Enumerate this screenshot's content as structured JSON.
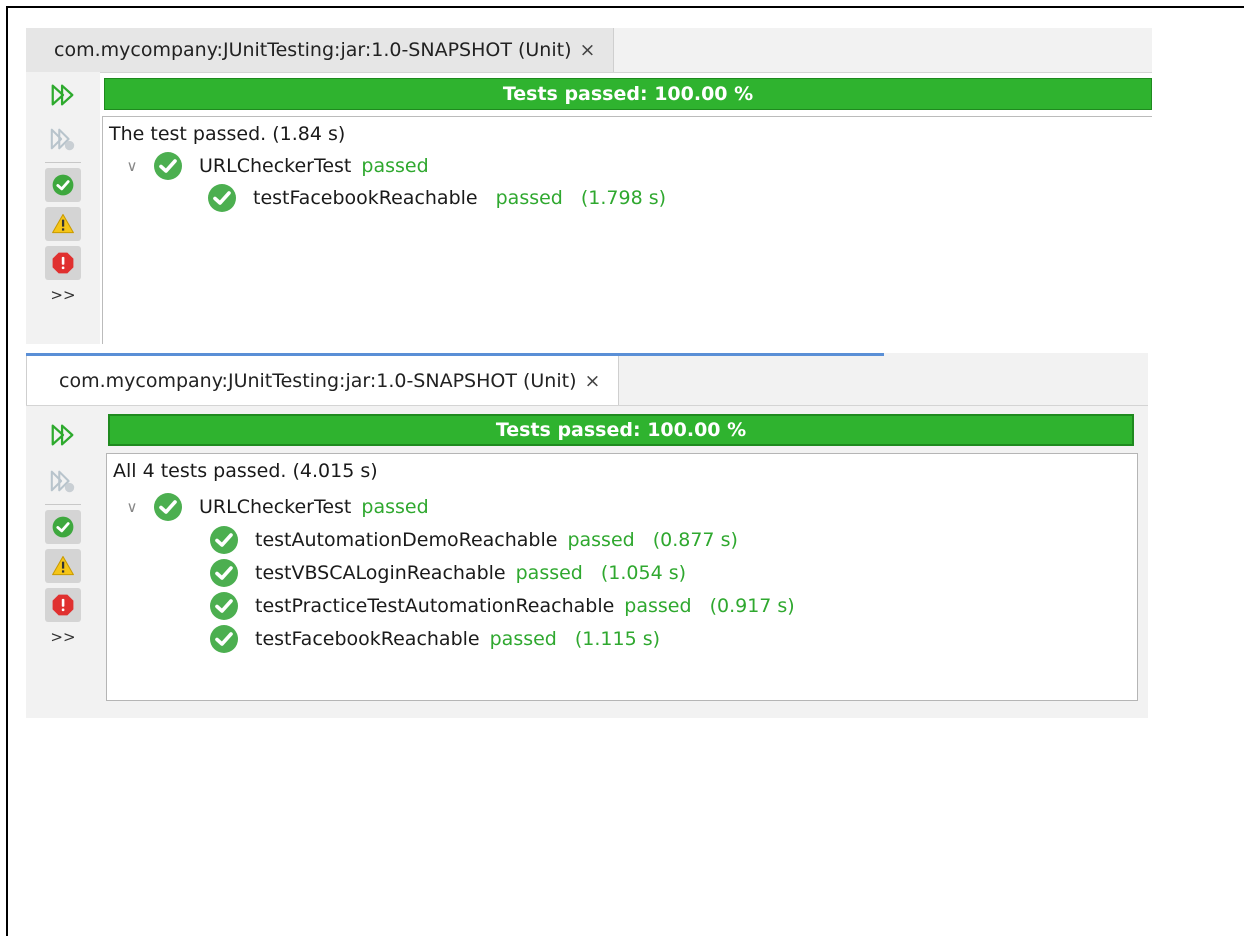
{
  "colors": {
    "progress_green": "#2fb32f",
    "passed_text": "#2fa82f",
    "check_green": "#4caf50"
  },
  "icons": {
    "rerun": "double-play-icon",
    "rerun_failed": "rerun-failed-icon",
    "filter_passed": "check-circle-icon",
    "filter_warning": "warning-triangle-icon",
    "filter_error": "error-octagon-icon",
    "more": "overflow-chevron-icon",
    "test_passed": "green-check-icon",
    "expand": "chevron-down-icon",
    "close": "close-icon"
  },
  "panel1": {
    "tab_title": "com.mycompany:JUnitTesting:jar:1.0-SNAPSHOT (Unit)",
    "close_glyph": "×",
    "progress_label": "Tests passed: 100.00 %",
    "progress_percent": 100,
    "more_label": ">>",
    "summary": "The test passed. (1.84 s)",
    "suite": {
      "name": "URLCheckerTest",
      "status": "passed"
    },
    "tests": [
      {
        "name": "testFacebookReachable",
        "status": "passed",
        "time": "(1.798 s)"
      }
    ]
  },
  "panel2": {
    "tab_title": "com.mycompany:JUnitTesting:jar:1.0-SNAPSHOT (Unit)",
    "close_glyph": "×",
    "progress_label": "Tests passed: 100.00 %",
    "progress_percent": 100,
    "more_label": ">>",
    "summary": "All 4 tests passed. (4.015 s)",
    "suite": {
      "name": "URLCheckerTest",
      "status": "passed"
    },
    "tests": [
      {
        "name": "testAutomationDemoReachable",
        "status": "passed",
        "time": "(0.877 s)"
      },
      {
        "name": "testVBSCALoginReachable",
        "status": "passed",
        "time": "(1.054 s)"
      },
      {
        "name": "testPracticeTestAutomationReachable",
        "status": "passed",
        "time": "(0.917 s)"
      },
      {
        "name": "testFacebookReachable",
        "status": "passed",
        "time": "(1.115 s)"
      }
    ]
  }
}
